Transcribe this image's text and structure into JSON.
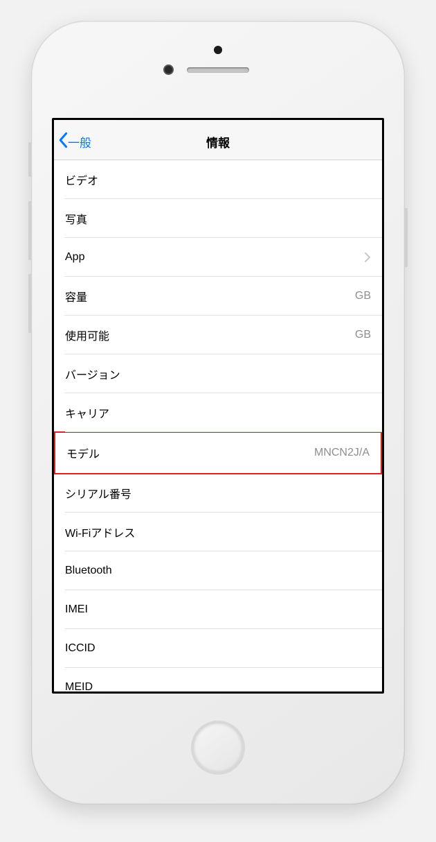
{
  "navbar": {
    "back_label": "一般",
    "title": "情報"
  },
  "rows": {
    "video": {
      "label": "ビデオ",
      "value": ""
    },
    "photos": {
      "label": "写真",
      "value": ""
    },
    "app": {
      "label": "App",
      "value": ""
    },
    "capacity": {
      "label": "容量",
      "value": "GB"
    },
    "available": {
      "label": "使用可能",
      "value": "GB"
    },
    "version": {
      "label": "バージョン",
      "value": ""
    },
    "carrier": {
      "label": "キャリア",
      "value": ""
    },
    "model": {
      "label": "モデル",
      "value": "MNCN2J/A"
    },
    "serial": {
      "label": "シリアル番号",
      "value": ""
    },
    "wifi": {
      "label": "Wi-Fiアドレス",
      "value": ""
    },
    "bluetooth": {
      "label": "Bluetooth",
      "value": ""
    },
    "imei": {
      "label": "IMEI",
      "value": ""
    },
    "iccid": {
      "label": "ICCID",
      "value": ""
    },
    "meid": {
      "label": "MEID",
      "value": ""
    }
  }
}
